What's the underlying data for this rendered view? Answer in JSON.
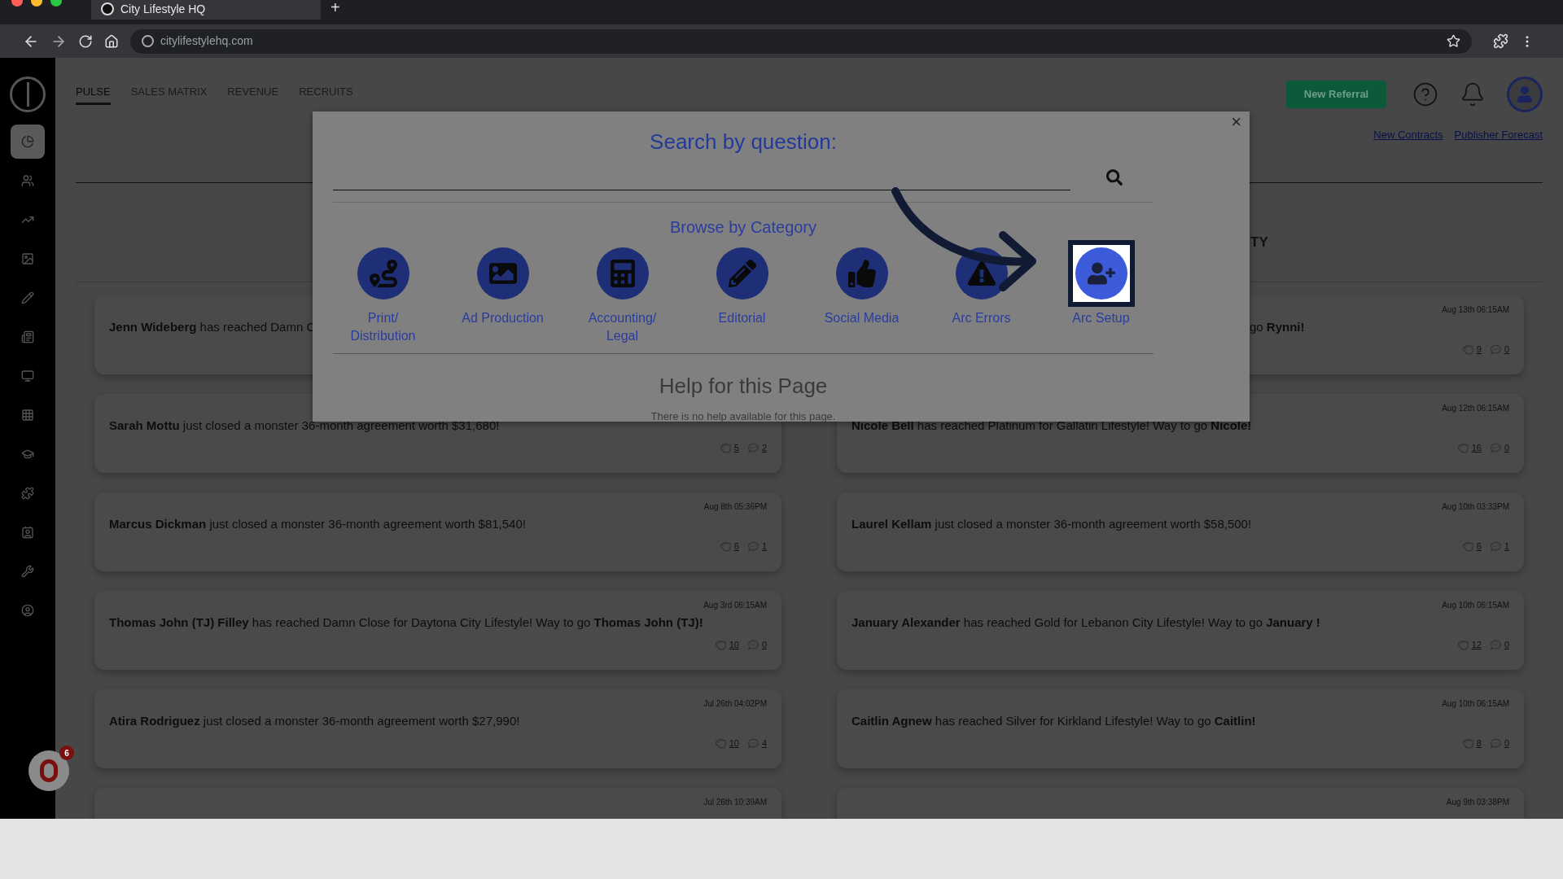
{
  "browser": {
    "tab_title": "City Lifestyle HQ",
    "new_tab": "+",
    "url": "citylifestylehq.com"
  },
  "sidebar": {
    "items": [
      {
        "kind": "pie",
        "selected": true
      },
      {
        "kind": "people",
        "selected": false
      },
      {
        "kind": "chart",
        "selected": false
      },
      {
        "kind": "image",
        "selected": false
      },
      {
        "kind": "pencil",
        "selected": false
      },
      {
        "kind": "newspaper",
        "selected": false
      },
      {
        "kind": "monitor",
        "selected": false
      },
      {
        "kind": "grid",
        "selected": false
      },
      {
        "kind": "cap",
        "selected": false
      },
      {
        "kind": "puzzle",
        "selected": false
      },
      {
        "kind": "contact",
        "selected": false
      },
      {
        "kind": "wrench",
        "selected": false
      },
      {
        "kind": "user",
        "selected": false
      }
    ],
    "badge": "6"
  },
  "nav_tabs": [
    {
      "label": "PULSE",
      "selected": true
    },
    {
      "label": "SALES MATRIX",
      "selected": false
    },
    {
      "label": "REVENUE",
      "selected": false
    },
    {
      "label": "RECRUITS",
      "selected": false
    }
  ],
  "new_referral_button": "New Referral",
  "header_links": [
    "New Contracts",
    "Publisher Forecast"
  ],
  "right_column": {
    "header": "TY"
  },
  "feed_left": [
    {
      "text": "**Jenn Wideberg** has reached Damn C"
    },
    {
      "text": "**Sarah Mottu** just closed a monster 36-month agreement worth $31,680!",
      "likes": "5",
      "comments": "2"
    },
    {
      "time": "Aug 8th 05:36PM",
      "text": "**Marcus Dickman** just closed a monster 36-month agreement worth $81,540!",
      "likes": "6",
      "comments": "1"
    },
    {
      "time": "Aug 3rd 06:15AM",
      "text": "**Thomas John (TJ) Filley** has reached Damn Close for Daytona City Lifestyle! Way to go **Thomas John (TJ)!**",
      "likes": "10",
      "comments": "0"
    },
    {
      "time": "Jul 26th 04:02PM",
      "text": "**Atira Rodriguez** just closed a monster 36-month agreement worth $27,990!",
      "likes": "10",
      "comments": "4"
    },
    {
      "time": "Jul 26th 10:39AM"
    }
  ],
  "feed_right": [
    {
      "time": "Aug 13th 06:15AM",
      "text": "go **Rynni!**",
      "likes": "9",
      "comments": "0"
    },
    {
      "time": "Aug 12th 06:15AM",
      "text": "**Nicole Bell** has reached Platinum for Gallatin Lifestyle! Way to go **Nicole!**",
      "likes": "16",
      "comments": "0"
    },
    {
      "time": "Aug 10th 03:33PM",
      "text": "**Laurel Kellam** just closed a monster 36-month agreement worth $58,500!",
      "likes": "6",
      "comments": "1"
    },
    {
      "time": "Aug 10th 06:15AM",
      "text": "**January Alexander** has reached Gold for Lebanon City Lifestyle! Way to go **January !**",
      "likes": "12",
      "comments": "0"
    },
    {
      "time": "Aug 10th 06:15AM",
      "text": "**Caitlin Agnew** has reached Silver for Kirkland Lifestyle! Way to go **Caitlin!**",
      "likes": "8",
      "comments": "0"
    },
    {
      "time": "Aug 9th 03:38PM"
    }
  ],
  "modal": {
    "title": "Search by question:",
    "close": "×",
    "browse_title": "Browse by Category",
    "categories": [
      {
        "kind": "route",
        "label": "Print/ Distribution",
        "highlighted": false
      },
      {
        "kind": "image",
        "label": "Ad Production",
        "highlighted": false
      },
      {
        "kind": "calculator",
        "label": "Accounting/ Legal",
        "highlighted": false
      },
      {
        "kind": "pencil",
        "label": "Editorial",
        "highlighted": false
      },
      {
        "kind": "thumb",
        "label": "Social Media",
        "highlighted": false
      },
      {
        "kind": "warning",
        "label": "Arc Errors",
        "highlighted": false
      },
      {
        "kind": "adduser",
        "label": "Arc Setup",
        "highlighted": true
      }
    ],
    "help_title": "Help for this Page",
    "help_text": "There is no help available for this page."
  }
}
